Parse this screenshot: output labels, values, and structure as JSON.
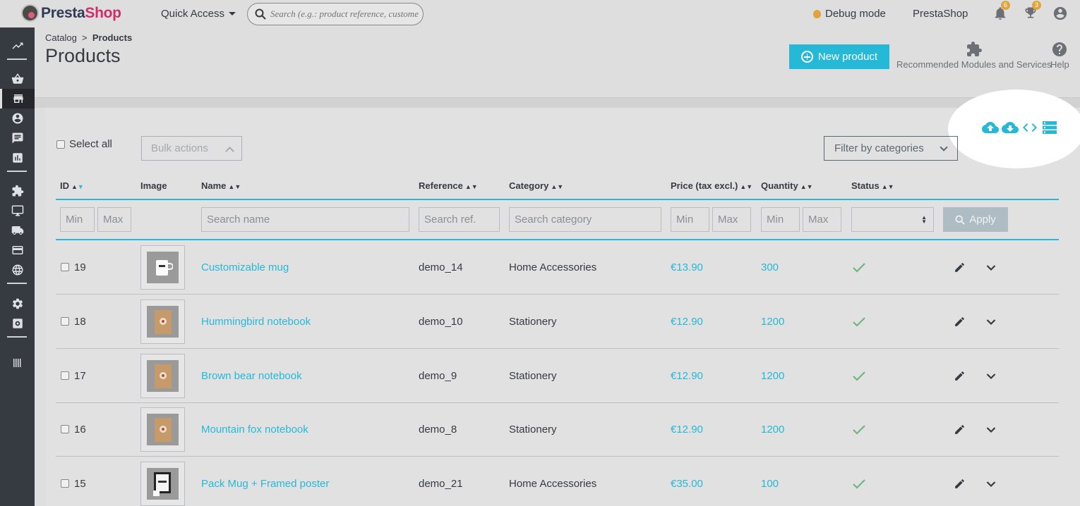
{
  "header": {
    "logo_a": "Presta",
    "logo_b": "Shop",
    "quick_access": "Quick Access",
    "search_placeholder": "Search (e.g.: product reference, customer name…)",
    "debug_mode": "Debug mode",
    "shop_name": "PrestaShop",
    "notifications_count": "6",
    "trophy_count": "3"
  },
  "breadcrumb": {
    "parent": "Catalog",
    "separator": ">",
    "current": "Products"
  },
  "page_title": "Products",
  "toolbar": {
    "new_product": "New product",
    "recommended": "Recommended Modules and Services",
    "help": "Help"
  },
  "list_actions": {
    "select_all": "Select all",
    "bulk_actions": "Bulk actions",
    "filter_by_categories": "Filter by categories",
    "icons": [
      "cloud-upload-icon",
      "cloud-download-icon",
      "code-icon",
      "list-settings-icon"
    ]
  },
  "columns": {
    "id": "ID",
    "image": "Image",
    "name": "Name",
    "reference": "Reference",
    "category": "Category",
    "price": "Price (tax excl.)",
    "quantity": "Quantity",
    "status": "Status",
    "sort_arrows": "▲▼"
  },
  "filters": {
    "min": "Min",
    "max": "Max",
    "search_name": "Search name",
    "search_ref": "Search ref.",
    "search_category": "Search category",
    "apply": "Apply"
  },
  "products": [
    {
      "id": "19",
      "name": "Customizable mug",
      "reference": "demo_14",
      "category": "Home Accessories",
      "price": "€13.90",
      "quantity": "300",
      "status": "enabled",
      "image": "mug"
    },
    {
      "id": "18",
      "name": "Hummingbird notebook",
      "reference": "demo_10",
      "category": "Stationery",
      "price": "€12.90",
      "quantity": "1200",
      "status": "enabled",
      "image": "notebook"
    },
    {
      "id": "17",
      "name": "Brown bear notebook",
      "reference": "demo_9",
      "category": "Stationery",
      "price": "€12.90",
      "quantity": "1200",
      "status": "enabled",
      "image": "notebook"
    },
    {
      "id": "16",
      "name": "Mountain fox notebook",
      "reference": "demo_8",
      "category": "Stationery",
      "price": "€12.90",
      "quantity": "1200",
      "status": "enabled",
      "image": "notebook"
    },
    {
      "id": "15",
      "name": "Pack Mug + Framed poster",
      "reference": "demo_21",
      "category": "Home Accessories",
      "price": "€35.00",
      "quantity": "100",
      "status": "enabled",
      "image": "poster"
    }
  ],
  "colors": {
    "accent": "#25b9d7",
    "sidebar": "#363a41",
    "success": "#70b580",
    "badge": "#e0a43a"
  }
}
